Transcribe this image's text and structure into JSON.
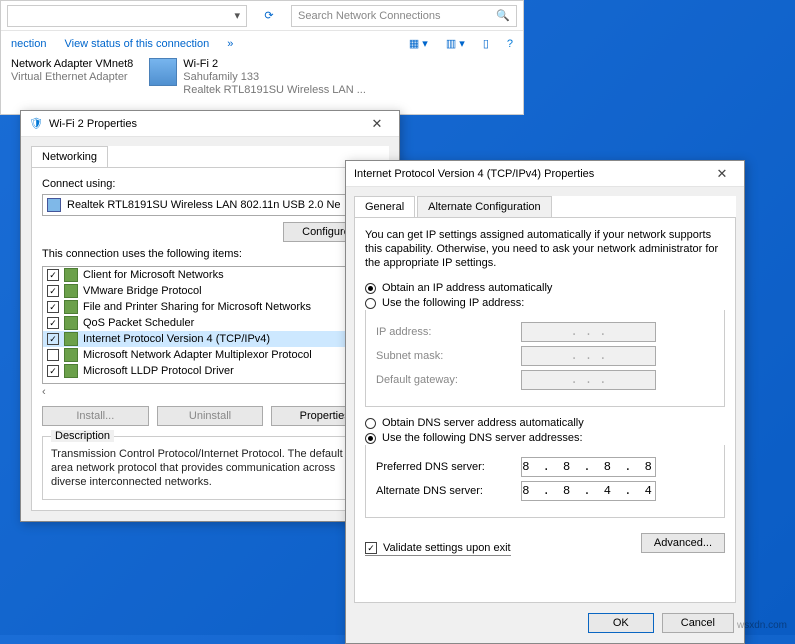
{
  "nc": {
    "search_placeholder": "Search Network Connections",
    "link_connection": "nection",
    "link_status": "View status of this connection",
    "adapter1_title": "Network Adapter VMnet8",
    "adapter1_sub": "Virtual Ethernet Adapter",
    "adapter2_title": "Wi-Fi 2",
    "adapter2_sub1": "Sahufamily   133",
    "adapter2_sub2": "Realtek RTL8191SU Wireless LAN ..."
  },
  "props": {
    "title": "Wi-Fi 2 Properties",
    "tab_networking": "Networking",
    "connect_using": "Connect using:",
    "adapter": "Realtek RTL8191SU Wireless LAN 802.11n USB 2.0 Ne",
    "configure": "Configure...",
    "uses_items": "This connection uses the following items:",
    "items": [
      {
        "checked": true,
        "label": "Client for Microsoft Networks"
      },
      {
        "checked": true,
        "label": "VMware Bridge Protocol"
      },
      {
        "checked": true,
        "label": "File and Printer Sharing for Microsoft Networks"
      },
      {
        "checked": true,
        "label": "QoS Packet Scheduler"
      },
      {
        "checked": true,
        "label": "Internet Protocol Version 4 (TCP/IPv4)",
        "selected": true
      },
      {
        "checked": false,
        "label": "Microsoft Network Adapter Multiplexor Protocol"
      },
      {
        "checked": true,
        "label": "Microsoft LLDP Protocol Driver"
      }
    ],
    "install": "Install...",
    "uninstall": "Uninstall",
    "properties": "Properties",
    "desc_label": "Description",
    "desc_text": "Transmission Control Protocol/Internet Protocol. The default wide area network protocol that provides communication across diverse interconnected networks."
  },
  "tcpip": {
    "title": "Internet Protocol Version 4 (TCP/IPv4) Properties",
    "tab_general": "General",
    "tab_alt": "Alternate Configuration",
    "explain": "You can get IP settings assigned automatically if your network supports this capability. Otherwise, you need to ask your network administrator for the appropriate IP settings.",
    "radio_auto_ip": "Obtain an IP address automatically",
    "radio_manual_ip": "Use the following IP address:",
    "ip_address": "IP address:",
    "subnet": "Subnet mask:",
    "gateway": "Default gateway:",
    "radio_auto_dns": "Obtain DNS server address automatically",
    "radio_manual_dns": "Use the following DNS server addresses:",
    "pref_dns": "Preferred DNS server:",
    "alt_dns": "Alternate DNS server:",
    "pref_dns_val": "8 . 8 . 8 . 8",
    "alt_dns_val": "8 . 8 . 4 . 4",
    "validate": "Validate settings upon exit",
    "advanced": "Advanced...",
    "ok": "OK",
    "cancel": "Cancel",
    "dots": ".     .     ."
  },
  "watermark": "wsxdn.com"
}
